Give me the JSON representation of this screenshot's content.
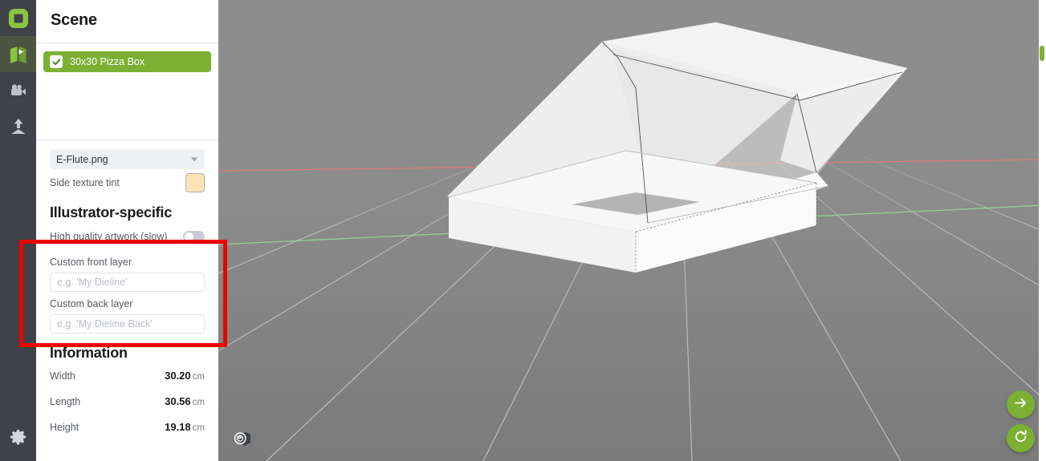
{
  "rail": {
    "items": [
      {
        "name": "logo-icon",
        "label": "Logo"
      },
      {
        "name": "model-icon",
        "label": "Model"
      },
      {
        "name": "camera-icon",
        "label": "Camera"
      },
      {
        "name": "export-icon",
        "label": "Export"
      }
    ],
    "settings_label": "Settings"
  },
  "panel": {
    "title": "Scene",
    "scene_item": {
      "label": "30x30 Pizza Box",
      "checked": true
    },
    "texture": {
      "value": "E-Flute.png"
    },
    "tint": {
      "label": "Side texture tint",
      "color": "#fae3b8"
    },
    "illustrator": {
      "heading": "Illustrator-specific",
      "hq_label": "High quality artwork (slow)",
      "hq_enabled": false,
      "front_layer_label": "Custom front layer",
      "front_layer_value": "",
      "front_layer_placeholder": "e.g. 'My Dieline'",
      "back_layer_label": "Custom back layer",
      "back_layer_value": "",
      "back_layer_placeholder": "e.g. 'My Dieline Back'"
    },
    "information": {
      "heading": "Information",
      "rows": [
        {
          "key": "Width",
          "value": "30.20",
          "unit": "cm"
        },
        {
          "key": "Length",
          "value": "30.56",
          "unit": "cm"
        },
        {
          "key": "Height",
          "value": "19.18",
          "unit": "cm"
        }
      ]
    }
  },
  "viewport": {
    "fit_view_label": "Fit view",
    "next_label": "Next",
    "reset_label": "Reset view",
    "model_name": "30x30 Pizza Box"
  },
  "annotation": {
    "color": "#ec0000",
    "target": "custom-layer-fields"
  },
  "colors": {
    "accent_green": "#7cb033",
    "rail_dark": "#3e4249",
    "rail_active": "#4e5442",
    "annotation_red": "#ec0000"
  }
}
